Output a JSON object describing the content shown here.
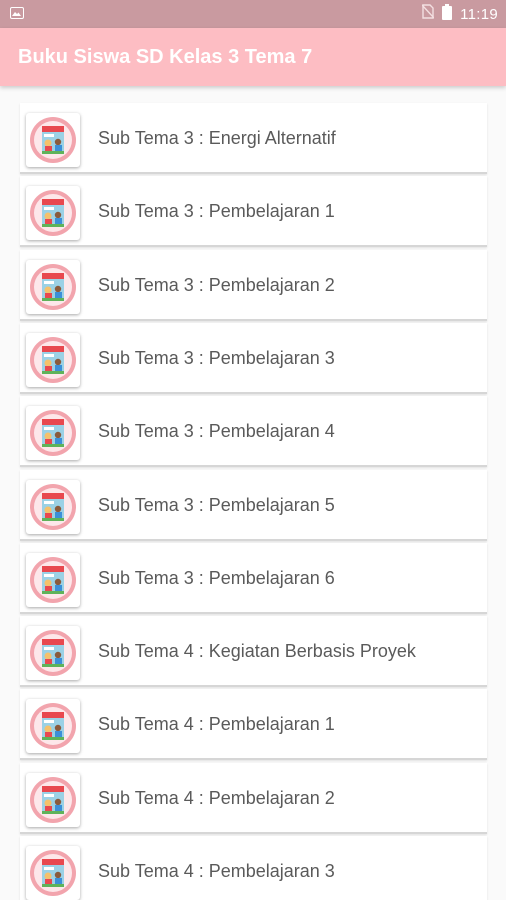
{
  "status_bar": {
    "time": "11:19",
    "icons": [
      "image-icon",
      "no-sim-icon",
      "battery-icon"
    ]
  },
  "app_bar": {
    "title": "Buku Siswa SD Kelas 3 Tema 7"
  },
  "colors": {
    "status_bar": "#c99aa0",
    "app_bar": "#fdbdc3",
    "background": "#fafafa",
    "text": "#5a5a5a"
  },
  "list": {
    "items": [
      {
        "label": "Sub Tema 3 : Energi Alternatif",
        "icon": "book-cover-icon"
      },
      {
        "label": "Sub Tema 3 : Pembelajaran 1",
        "icon": "book-cover-icon"
      },
      {
        "label": "Sub Tema 3 : Pembelajaran 2",
        "icon": "book-cover-icon"
      },
      {
        "label": "Sub Tema 3 : Pembelajaran 3",
        "icon": "book-cover-icon"
      },
      {
        "label": "Sub Tema 3 : Pembelajaran 4",
        "icon": "book-cover-icon"
      },
      {
        "label": "Sub Tema 3 : Pembelajaran 5",
        "icon": "book-cover-icon"
      },
      {
        "label": "Sub Tema 3 : Pembelajaran 6",
        "icon": "book-cover-icon"
      },
      {
        "label": "Sub Tema 4 : Kegiatan Berbasis Proyek",
        "icon": "book-cover-icon"
      },
      {
        "label": "Sub Tema 4 : Pembelajaran 1",
        "icon": "book-cover-icon"
      },
      {
        "label": "Sub Tema 4 : Pembelajaran 2",
        "icon": "book-cover-icon"
      },
      {
        "label": "Sub Tema 4 : Pembelajaran 3",
        "icon": "book-cover-icon"
      }
    ]
  }
}
